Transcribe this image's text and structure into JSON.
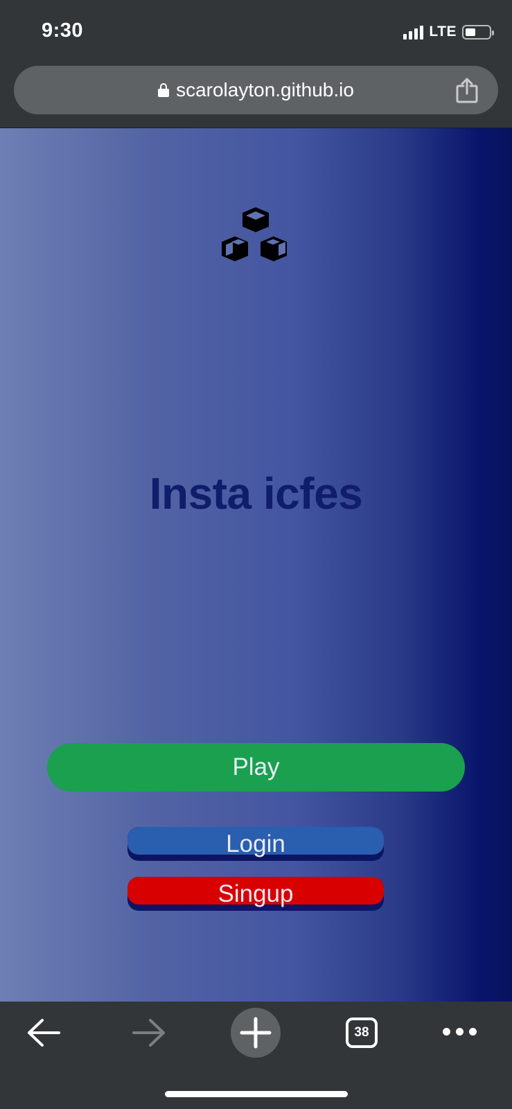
{
  "status_bar": {
    "time": "9:30",
    "network": "LTE",
    "icons": [
      "signal-icon",
      "battery-icon"
    ]
  },
  "browser": {
    "url": "scarolayton.github.io",
    "icons": [
      "lock-icon",
      "share-icon"
    ],
    "toolbar": {
      "open_tabs_count": "38",
      "icons": [
        "back-arrow-icon",
        "forward-arrow-icon",
        "plus-icon",
        "tabs-icon",
        "more-icon"
      ]
    }
  },
  "page": {
    "logo_icon": "cubes-icon",
    "title": "Insta icfes",
    "buttons": {
      "play": "Play",
      "login": "Login",
      "signup": "Singup"
    },
    "colors": {
      "title": "#0f1d6b",
      "play": "#1aa04e",
      "login": "#2a5eaf",
      "signup": "#d80000",
      "button_shadow": "#0c1562",
      "gradient_start": "#6e7fb4",
      "gradient_end": "#081360"
    }
  }
}
